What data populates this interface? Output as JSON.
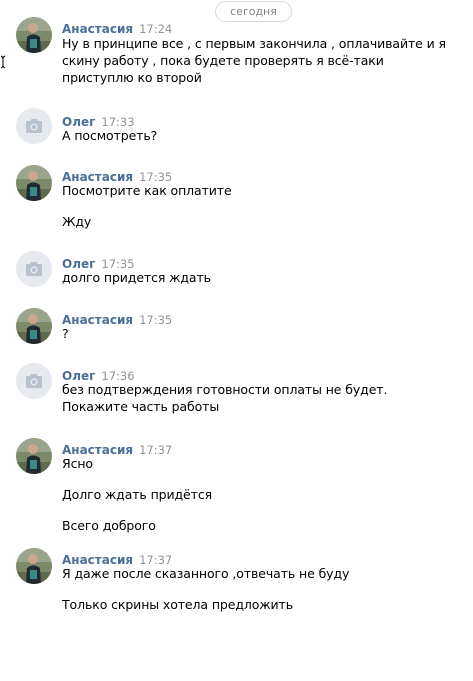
{
  "date_label": "сегодня",
  "messages": [
    {
      "author": "Анастасия",
      "time": "17:24",
      "lines": [
        "Ну в принципе все , с первым закончила , оплачивайте и я скину работу , пока будете проверять я всё-таки приступлю ко второй"
      ]
    },
    {
      "author": "Олег",
      "time": "17:33",
      "lines": [
        "А посмотреть?"
      ]
    },
    {
      "author": "Анастасия",
      "time": "17:35",
      "lines": [
        "Посмотрите как оплатите",
        "Жду"
      ]
    },
    {
      "author": "Олег",
      "time": "17:35",
      "lines": [
        "долго придется ждать"
      ]
    },
    {
      "author": "Анастасия",
      "time": "17:35",
      "lines": [
        "?"
      ]
    },
    {
      "author": "Олег",
      "time": "17:36",
      "lines": [
        "без подтверждения готовности оплаты не будет. Покажите часть работы"
      ]
    },
    {
      "author": "Анастасия",
      "time": "17:37",
      "lines": [
        "Ясно",
        "Долго ждать придётся",
        "Всего доброго"
      ]
    },
    {
      "author": "Анастасия",
      "time": "17:37",
      "lines": [
        "Я даже после сказанного ,отвечать не буду",
        "Только скрины хотела предложить"
      ]
    }
  ],
  "colors": {
    "author_name": "#4a6f99",
    "timestamp": "#939393",
    "camera_avatar_bg": "#e6e9ed",
    "date_badge_border": "#d3d9de"
  },
  "icons": {
    "anastasia_avatar": "user-photo-avatar",
    "oleg_avatar": "camera-icon"
  }
}
